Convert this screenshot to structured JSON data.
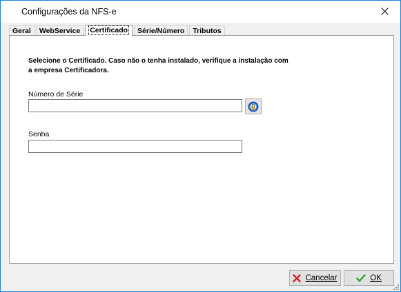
{
  "window": {
    "title": "Configurações da NFS-e",
    "close_label": "✕"
  },
  "tabs": [
    {
      "label": "Geral"
    },
    {
      "label": "WebService"
    },
    {
      "label": "Certificado",
      "active": true
    },
    {
      "label": "Série/Número"
    },
    {
      "label": "Tributos"
    }
  ],
  "certificado": {
    "instructions": "Selecione o Certificado. Caso não o tenha instalado, verifique a instalação com a empresa Certificadora.",
    "serial_label": "Número de Série",
    "serial_value": "",
    "password_label": "Senha",
    "password_value": ""
  },
  "footer": {
    "cancel_label": "Cancelar",
    "ok_label": "OK"
  },
  "icons": {
    "lookup": "certificate-lookup-icon",
    "cancel": "red-x-icon",
    "ok": "green-check-icon"
  }
}
